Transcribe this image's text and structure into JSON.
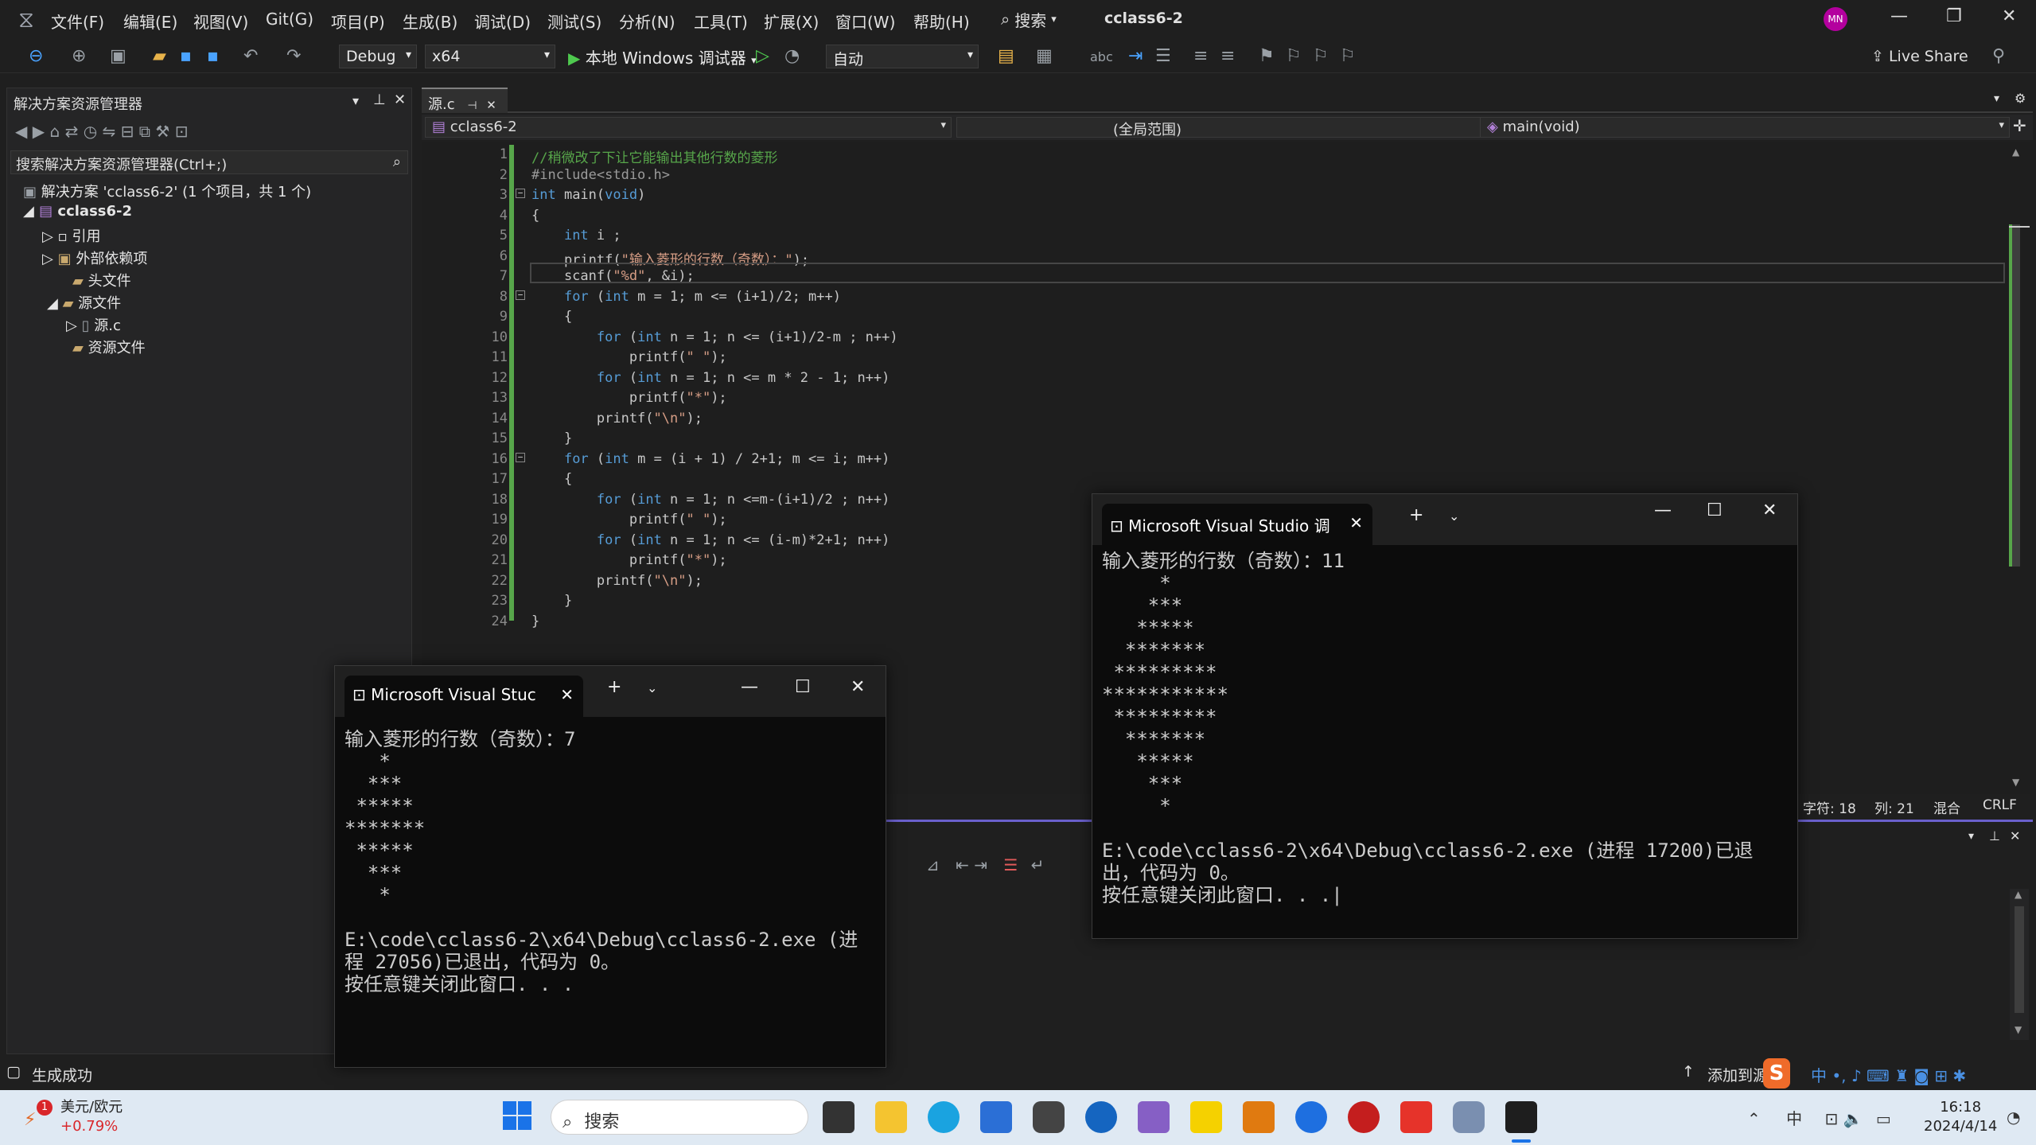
{
  "menu": {
    "items": [
      "文件(F)",
      "编辑(E)",
      "视图(V)",
      "Git(G)",
      "项目(P)",
      "生成(B)",
      "调试(D)",
      "测试(S)",
      "分析(N)",
      "工具(T)",
      "扩展(X)",
      "窗口(W)",
      "帮助(H)"
    ],
    "search_label": "搜索",
    "app_name": "cclass6-2",
    "avatar_initials": "MN"
  },
  "toolbar": {
    "config": "Debug",
    "platform": "x64",
    "run_label": "本地 Windows 调试器",
    "mode": "自动",
    "live_share": "Live Share"
  },
  "solution_explorer": {
    "title": "解决方案资源管理器",
    "search_placeholder": "搜索解决方案资源管理器(Ctrl+;)",
    "solution_label": "解决方案 'cclass6-2' (1 个项目，共 1 个)",
    "project": "cclass6-2",
    "items": [
      "引用",
      "外部依赖项",
      "头文件",
      "源文件",
      "源.c",
      "资源文件"
    ]
  },
  "editor": {
    "tab": "源.c",
    "nav_project": "cclass6-2",
    "nav_scope": "(全局范围)",
    "nav_func": "main(void)",
    "lines": [
      "//稍微改了下让它能输出其他行数的菱形",
      "#include<stdio.h>",
      "int main(void)",
      "{",
      "    int i ;",
      "    printf(\"输入菱形的行数（奇数）：\");",
      "    scanf(\"%d\", &i);",
      "    for (int m = 1; m <= (i+1)/2; m++)",
      "    {",
      "        for (int n = 1; n <= (i+1)/2-m ; n++)",
      "            printf(\" \");",
      "        for (int n = 1; n <= m * 2 - 1; n++)",
      "            printf(\"*\");",
      "        printf(\"\\n\");",
      "    }",
      "    for (int m = (i + 1) / 2+1; m <= i; m++)",
      "    {",
      "        for (int n = 1; n <=m-(i+1)/2 ; n++)",
      "            printf(\" \");",
      "        for (int n = 1; n <= (i-m)*2+1; n++)",
      "            printf(\"*\");",
      "        printf(\"\\n\");",
      "    }",
      "}"
    ],
    "status_chars": "字符: 18",
    "status_col": "列: 21",
    "status_mixed": "混合",
    "status_eol": "CRLF"
  },
  "statusbar": {
    "build": "生成成功",
    "add_source": "添加到源"
  },
  "console1": {
    "title": "Microsoft Visual Stuc",
    "output": "输入菱形的行数（奇数）：7\n   *\n  ***\n *****\n*******\n *****\n  ***\n   *\n\nE:\\code\\cclass6-2\\x64\\Debug\\cclass6-2.exe (进\n程 27056)已退出，代码为 0。\n按任意键关闭此窗口. . ."
  },
  "console2": {
    "title": "Microsoft Visual Studio 调",
    "output": "输入菱形的行数（奇数）：11\n     *\n    ***\n   *****\n  *******\n *********\n***********\n *********\n  *******\n   *****\n    ***\n     *\n\nE:\\code\\cclass6-2\\x64\\Debug\\cclass6-2.exe (进程 17200)已退\n出，代码为 0。\n按任意键关闭此窗口. . .|"
  },
  "taskbar": {
    "weather_label": "美元/欧元",
    "weather_value": "+0.79%",
    "badge": "1",
    "search": "搜索",
    "time": "16:18",
    "date": "2024/4/14"
  },
  "colors": {
    "keyword": "#569cd6",
    "comment": "#57a64a",
    "string": "#d69d85",
    "accent": "#6a60cc"
  }
}
